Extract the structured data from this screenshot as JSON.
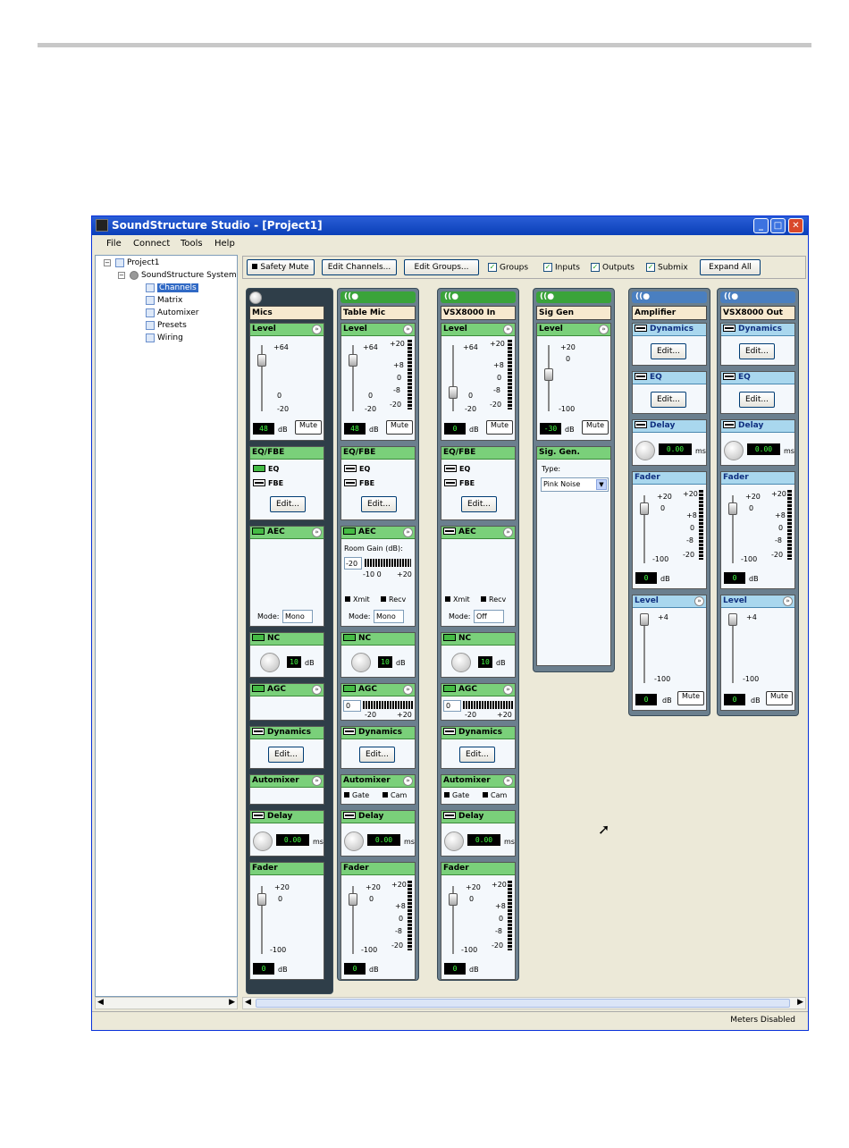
{
  "window": {
    "title": "SoundStructure Studio - [Project1]"
  },
  "menu": [
    "File",
    "Connect",
    "Tools",
    "Help"
  ],
  "tree": {
    "root": "Project1",
    "system": "SoundStructure System",
    "items": [
      "Channels",
      "Matrix",
      "Automixer",
      "Presets",
      "Wiring"
    ]
  },
  "toolbar": {
    "safety_mute": "Safety Mute",
    "edit_channels": "Edit Channels...",
    "edit_groups": "Edit Groups...",
    "checks": [
      "Groups",
      "Inputs",
      "Outputs",
      "Submix"
    ],
    "expand_all": "Expand All"
  },
  "channels": [
    {
      "name": "Mics",
      "level": "48",
      "nc": "10",
      "delay": "0.00",
      "fader": "0",
      "aec_mode": "Mono"
    },
    {
      "name": "Table Mic",
      "level": "48",
      "nc": "10",
      "delay": "0.00",
      "fader": "0",
      "aec_mode": "Mono",
      "agc": "0",
      "room_gain_value": "-20"
    },
    {
      "name": "VSX8000 In",
      "level": "0",
      "nc": "10",
      "delay": "0.00",
      "fader": "0",
      "aec_mode": "Off",
      "agc": "0"
    },
    {
      "name": "Sig Gen",
      "level": "-30",
      "siggen_type": "Pink Noise"
    },
    {
      "name": "Amplifier",
      "delay": "0.00",
      "fader": "0",
      "level": "0"
    },
    {
      "name": "VSX8000 Out",
      "delay": "0.00",
      "fader": "0",
      "level": "0"
    }
  ],
  "labels": {
    "level": "Level",
    "eqfbe": "EQ/FBE",
    "eq": "EQ",
    "fbe": "FBE",
    "edit": "Edit...",
    "aec": "AEC",
    "nc": "NC",
    "agc": "AGC",
    "dynamics": "Dynamics",
    "automixer": "Automixer",
    "delay": "Delay",
    "fader": "Fader",
    "mute": "Mute",
    "db": "dB",
    "ms": "ms",
    "mode": "Mode:",
    "room_gain": "Room Gain (dB):",
    "xmit": "Xmit",
    "recv": "Recv",
    "gate": "Gate",
    "cam": "Cam",
    "siggen": "Sig. Gen.",
    "type": "Type:",
    "p64": "+64",
    "p20": "+20",
    "p8": "+8",
    "p4": "+4",
    "z0": "0",
    "m8": "-8",
    "m10": "-10 0",
    "m20": "-20",
    "m100": "-100",
    "mn20": "-20",
    "pl20": "+20"
  },
  "status": {
    "meters": "Meters Disabled"
  }
}
